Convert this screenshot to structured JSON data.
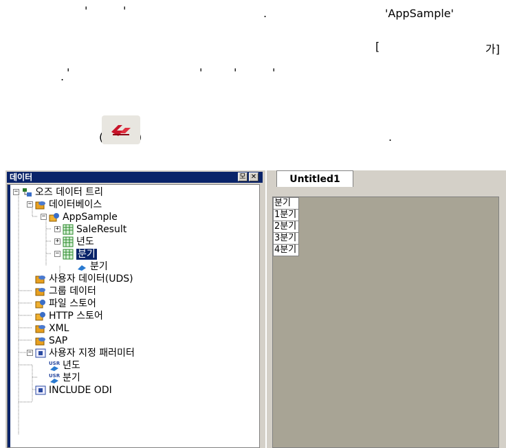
{
  "doc_text": {
    "line1_ticks": [
      "'",
      "'"
    ],
    "line1_dot": ".",
    "line1_app": "'AppSample'",
    "line2_bracket_open": "[",
    "line2_ga": "가]",
    "line3_dot": ".",
    "line3_ticks": [
      "'",
      "'",
      "'",
      "'"
    ],
    "paren_open": "(",
    "paren_close": ")",
    "line4_dot": "."
  },
  "panel": {
    "title": "데이터",
    "pin_button": "모",
    "close_button": "✕"
  },
  "tree": [
    {
      "label": "오즈 데이터 트리",
      "icon": "tree-root-icon",
      "level": 0,
      "expander": "−"
    },
    {
      "label": "데이터베이스",
      "icon": "database-icon",
      "level": 1,
      "expander": "−"
    },
    {
      "label": "AppSample",
      "icon": "db-connection-icon",
      "level": 2,
      "expander": "−"
    },
    {
      "label": "SaleResult",
      "icon": "table-icon",
      "level": 3,
      "expander": "+"
    },
    {
      "label": "년도",
      "icon": "table-icon",
      "level": 3,
      "expander": "+"
    },
    {
      "label": "분기",
      "icon": "table-icon",
      "level": 3,
      "expander": "−",
      "selected": true
    },
    {
      "label": "분기",
      "icon": "field-icon",
      "level": 4
    },
    {
      "label": "사용자 데이터(UDS)",
      "icon": "database-icon",
      "level": 1
    },
    {
      "label": "그룹 데이터",
      "icon": "database-icon",
      "level": 1
    },
    {
      "label": "파일 스토어",
      "icon": "db-connection-icon",
      "level": 1
    },
    {
      "label": "HTTP 스토어",
      "icon": "db-connection-icon",
      "level": 1
    },
    {
      "label": "XML",
      "icon": "database-icon",
      "level": 1
    },
    {
      "label": "SAP",
      "icon": "database-icon",
      "level": 1
    },
    {
      "label": "사용자 지정 패러미터",
      "icon": "parameter-folder-icon",
      "level": 1,
      "expander": "−"
    },
    {
      "label": "년도",
      "icon": "user-param-icon",
      "level": 2
    },
    {
      "label": "분기",
      "icon": "user-param-icon",
      "level": 2
    },
    {
      "label": "INCLUDE ODI",
      "icon": "parameter-folder-icon",
      "level": 1
    }
  ],
  "editor": {
    "tab_label": "Untitled1",
    "cells": [
      "분기",
      "1분기",
      "2분기",
      "3분기",
      "4분기"
    ]
  },
  "colors": {
    "titlebar": "#0a246a",
    "panel_bg": "#d4d0c8",
    "sheet_bg": "#a8a495",
    "selection": "#0a246a"
  }
}
